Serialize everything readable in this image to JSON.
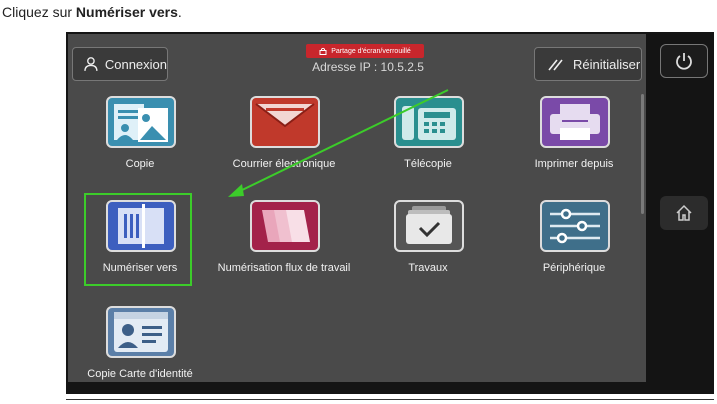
{
  "instruction": {
    "prefix": "Cliquez sur ",
    "target": "Numériser vers",
    "suffix": "."
  },
  "topbar": {
    "login_label": "Connexion",
    "share_badge": "Partage d'écran/verrouillé",
    "ip_address": "Adresse IP : 10.5.2.5",
    "reset_label": "Réinitialiser"
  },
  "apps": [
    {
      "label": "Copie",
      "icon": "copy-icon",
      "color": "#3a8fb0"
    },
    {
      "label": "Courrier électronique",
      "icon": "email-icon",
      "color": "#c0392b"
    },
    {
      "label": "Télécopie",
      "icon": "fax-icon",
      "color": "#2a8f8f"
    },
    {
      "label": "Imprimer depuis",
      "icon": "printer-icon",
      "color": "#7a4aa8"
    },
    {
      "label": "Numériser vers",
      "icon": "scan-icon",
      "color": "#3d5fbf"
    },
    {
      "label": "Numérisation flux de travail",
      "icon": "workflow-scan-icon",
      "color": "#a3224a"
    },
    {
      "label": "Travaux",
      "icon": "jobs-icon",
      "color": "#555555"
    },
    {
      "label": "Périphérique",
      "icon": "device-icon",
      "color": "#3f6f8a"
    },
    {
      "label": "Copie Carte d'identité",
      "icon": "id-card-copy-icon",
      "color": "#5b7fa8"
    }
  ],
  "side": {
    "power": "power-icon",
    "home": "home-icon"
  },
  "colors": {
    "highlight": "#3ccc2a",
    "arrow": "#3ccc2a"
  }
}
